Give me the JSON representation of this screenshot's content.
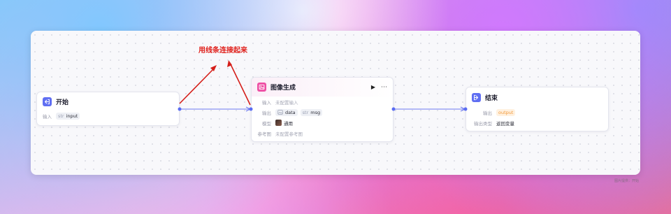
{
  "annotation": "用线条连接起来",
  "watermark": "图片提供：开始",
  "colors": {
    "accent": "#5a6cf2",
    "start_icon": "#5f6ef2",
    "image_icon": "#ee4fa4",
    "end_icon": "#5f6ef2",
    "annotation": "#e0201b"
  },
  "start_node": {
    "icon": "login-arrow-icon",
    "title": "开始",
    "input_label": "输入",
    "input_type": "str",
    "input_name": "input"
  },
  "image_node": {
    "icon": "image-icon",
    "title": "图像生成",
    "run_icon": "play-icon",
    "more_icon": "more-dots-icon",
    "input_label": "输入",
    "input_value": "未配置输入",
    "output_label": "输出",
    "outputs": [
      {
        "type": "img",
        "name": "data"
      },
      {
        "type": "str",
        "name": "msg"
      }
    ],
    "model_label": "模型",
    "model_value": "通用",
    "ref_label": "参考图",
    "ref_value": "未配置参考图"
  },
  "end_node": {
    "icon": "exit-arrow-icon",
    "title": "结束",
    "output_label": "输出",
    "output_name": "output",
    "output_type_label": "输出类型",
    "output_type_value": "返回变量"
  }
}
